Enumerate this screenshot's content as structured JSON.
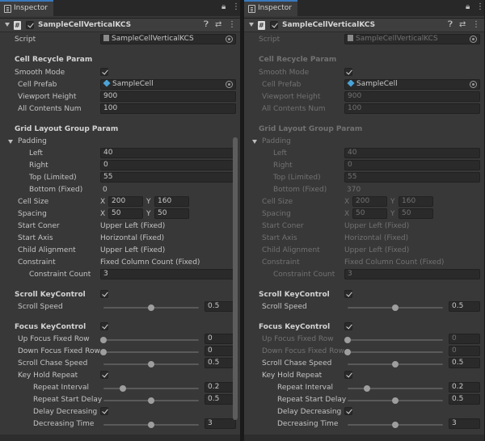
{
  "panels": [
    {
      "tab_label": "Inspector",
      "component_title": "SampleCellVerticalKCS",
      "script_label": "Script",
      "script_value": "SampleCellVerticalKCS",
      "cell_recycle_header": "Cell Recycle Param",
      "smooth_mode_label": "Smooth Mode",
      "cell_prefab_label": "Cell Prefab",
      "cell_prefab_value": "SampleCell",
      "viewport_height_label": "Viewport Height",
      "viewport_height_value": "900",
      "all_contents_label": "All Contents Num",
      "all_contents_value": "100",
      "grid_header": "Grid Layout Group Param",
      "padding_label": "Padding",
      "left_label": "Left",
      "left_value": "40",
      "right_label": "Right",
      "right_value": "0",
      "top_label": "Top   (Limited)",
      "top_value": "55",
      "bottom_label": "Bottom   (Fixed)",
      "bottom_value": "0",
      "cell_size_label": "Cell Size",
      "cell_size_x": "200",
      "cell_size_y": "160",
      "spacing_label": "Spacing",
      "spacing_x": "50",
      "spacing_y": "50",
      "x_label": "X",
      "y_label": "Y",
      "start_corner_label": "Start Coner",
      "start_corner_value": "Upper Left   (Fixed)",
      "start_axis_label": "Start Axis",
      "start_axis_value": "Horizontal   (Fixed)",
      "child_alignment_label": "Child Alignment",
      "child_alignment_value": "Upper Left   (Fixed)",
      "constraint_label": "Constraint",
      "constraint_value": "Fixed Column Count   (Fixed)",
      "constraint_count_label": "Constraint Count",
      "constraint_count_value": "3",
      "scroll_key_header": "Scroll KeyControl",
      "scroll_speed_label": "Scroll Speed",
      "scroll_speed_value": "0.5",
      "focus_key_header": "Focus KeyControl",
      "up_focus_label": "Up Focus Fixed Row",
      "up_focus_value": "0",
      "down_focus_label": "Down Focus Fixed Row",
      "down_focus_value": "0",
      "scroll_chase_label": "Scroll Chase Speed",
      "scroll_chase_value": "0.5",
      "key_hold_label": "Key Hold Repeat",
      "repeat_interval_label": "Repeat Interval",
      "repeat_interval_value": "0.2",
      "repeat_start_label": "Repeat Start Delay",
      "repeat_start_value": "0.5",
      "delay_decreasing_label": "Delay Decreasing",
      "decreasing_time_label": "Decreasing Time",
      "decreasing_time_value": "3",
      "lock_icon": "lock-icon",
      "menu_icon": "kebab-menu-icon"
    },
    {
      "tab_label": "Inspector",
      "component_title": "SampleCellVerticalKCS",
      "script_label": "Script",
      "script_value": "SampleCellVerticalKCS",
      "cell_recycle_header": "Cell Recycle Param",
      "smooth_mode_label": "Smooth Mode",
      "cell_prefab_label": "Cell Prefab",
      "cell_prefab_value": "SampleCell",
      "viewport_height_label": "Viewport Height",
      "viewport_height_value": "900",
      "all_contents_label": "All Contents Num",
      "all_contents_value": "100",
      "grid_header": "Grid Layout Group Param",
      "padding_label": "Padding",
      "left_label": "Left",
      "left_value": "40",
      "right_label": "Right",
      "right_value": "0",
      "top_label": "Top   (Limited)",
      "top_value": "55",
      "bottom_label": "Bottom   (Fixed)",
      "bottom_value": "370",
      "cell_size_label": "Cell Size",
      "cell_size_x": "200",
      "cell_size_y": "160",
      "spacing_label": "Spacing",
      "spacing_x": "50",
      "spacing_y": "50",
      "x_label": "X",
      "y_label": "Y",
      "start_corner_label": "Start Coner",
      "start_corner_value": "Upper Left   (Fixed)",
      "start_axis_label": "Start Axis",
      "start_axis_value": "Horizontal   (Fixed)",
      "child_alignment_label": "Child Alignment",
      "child_alignment_value": "Upper Left   (Fixed)",
      "constraint_label": "Constraint",
      "constraint_value": "Fixed Column Count   (Fixed)",
      "constraint_count_label": "Constraint Count",
      "constraint_count_value": "3",
      "scroll_key_header": "Scroll KeyControl",
      "scroll_speed_label": "Scroll Speed",
      "scroll_speed_value": "0.5",
      "focus_key_header": "Focus KeyControl",
      "up_focus_label": "Up Focus Fixed Row",
      "up_focus_value": "0",
      "down_focus_label": "Down Focus Fixed Row",
      "down_focus_value": "0",
      "scroll_chase_label": "Scroll Chase Speed",
      "scroll_chase_value": "0.5",
      "key_hold_label": "Key Hold Repeat",
      "repeat_interval_label": "Repeat Interval",
      "repeat_interval_value": "0.2",
      "repeat_start_label": "Repeat Start Delay",
      "repeat_start_value": "0.5",
      "delay_decreasing_label": "Delay Decreasing",
      "decreasing_time_label": "Decreasing Time",
      "decreasing_time_value": "3",
      "lock_icon": "lock-icon",
      "menu_icon": "kebab-menu-icon"
    }
  ],
  "sliders": {
    "scroll_speed": 0.5,
    "up_focus": 0,
    "down_focus": 0,
    "scroll_chase": 0.5,
    "repeat_interval": 0.2,
    "repeat_start": 0.5,
    "decreasing_time": 0.5
  },
  "colors": {
    "accent_tab": "#3a79bb",
    "panel_bg": "#383838",
    "field_bg": "#2a2a2a"
  }
}
